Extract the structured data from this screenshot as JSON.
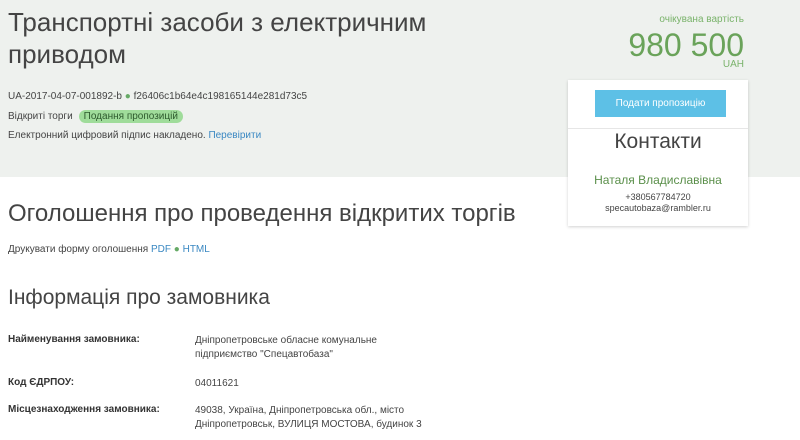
{
  "tender": {
    "title": "Транспортні засоби з електричним приводом",
    "tender_id": "UA-2017-04-07-001892-b",
    "hash": "f26406c1b64e4c198165144e281d73c5",
    "procedure_type": "Відкриті торги",
    "status": "Подання пропозицій",
    "signature_text": "Електронний цифровий підпис накладено.",
    "signature_link": "Перевірити"
  },
  "value": {
    "label": "очікувана вартість",
    "amount": "980 500",
    "currency": "UAH"
  },
  "contact_card": {
    "bid_button": "Подати пропозицію",
    "title": "Контакти",
    "name": "Наталя Владиславівна",
    "phone": "+380567784720",
    "email": "specautobaza@rambler.ru"
  },
  "announcement": {
    "heading": "Оголошення про проведення відкритих торгів",
    "print_text": "Друкувати форму оголошення",
    "print_pdf": "PDF",
    "print_html": "HTML"
  },
  "customer": {
    "heading": "Інформація про замовника",
    "rows": [
      {
        "label": "Найменування замовника:",
        "value": "Дніпропетровське обласне комунальне підприємство \"Спецавтобаза\""
      },
      {
        "label": "Код ЄДРПОУ:",
        "value": "04011621"
      },
      {
        "label": "Місцезнаходження замовника:",
        "value": "49038, Україна, Дніпропетровська обл., місто Дніпропетровськ, ВУЛИЦЯ МОСТОВА, будинок 3"
      }
    ]
  },
  "colors": {
    "band_bg": "#eef1ee",
    "accent_green": "#6aa35a",
    "badge_green": "#9fdc9a",
    "button_blue": "#5dc0e6",
    "link_blue": "#3a88c2"
  }
}
